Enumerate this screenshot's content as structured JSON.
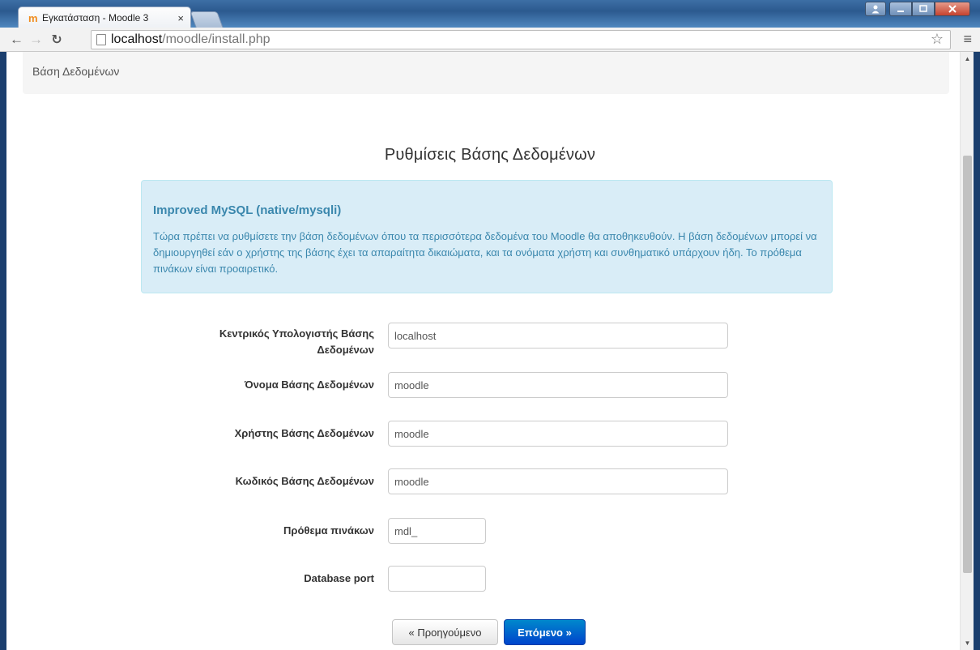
{
  "browser": {
    "tab_title": "Εγκατάσταση - Moodle 3",
    "tab_close": "×",
    "favicon": "m",
    "url_host": "localhost",
    "url_path": "/moodle/install.php",
    "back_icon": "arrow-left-icon",
    "forward_icon": "arrow-right-icon",
    "reload_icon": "reload-icon",
    "star_icon": "star-icon",
    "menu_icon": "hamburger-menu-icon"
  },
  "page": {
    "breadcrumb": "Βάση Δεδομένων",
    "heading": "Ρυθμίσεις Βάσης Δεδομένων",
    "alert": {
      "title": "Improved MySQL (native/mysqli)",
      "text": "Τώρα πρέπει να ρυθμίσετε την βάση δεδομένων όπου τα περισσότερα δεδομένα του Moodle θα αποθηκευθούν. Η βάση δεδομένων μπορεί να δημιουργηθεί εάν ο χρήστης της βάσης έχει τα απαραίτητα δικαιώματα, και τα ονόματα χρήστη και συνθηματικό υπάρχουν ήδη. Το πρόθεμα πινάκων είναι προαιρετικό.",
      "color": "#3a87ad",
      "background": "#d9edf7"
    },
    "fields": [
      {
        "label": "Κεντρικός Υπολογιστής Βάσης Δεδομένων",
        "value": "localhost"
      },
      {
        "label": "Όνομα Βάσης Δεδομένων",
        "value": "moodle"
      },
      {
        "label": "Χρήστης Βάσης Δεδομένων",
        "value": "moodle"
      },
      {
        "label": "Κωδικός Βάσης Δεδομένων",
        "value": "moodle"
      },
      {
        "label": "Πρόθεμα πινάκων",
        "value": "mdl_"
      },
      {
        "label": "Database port",
        "value": ""
      }
    ],
    "buttons": {
      "prev_label": "« Προηγούμενο",
      "next_label": "Επόμενο »",
      "next_color": "#0055cc"
    }
  }
}
